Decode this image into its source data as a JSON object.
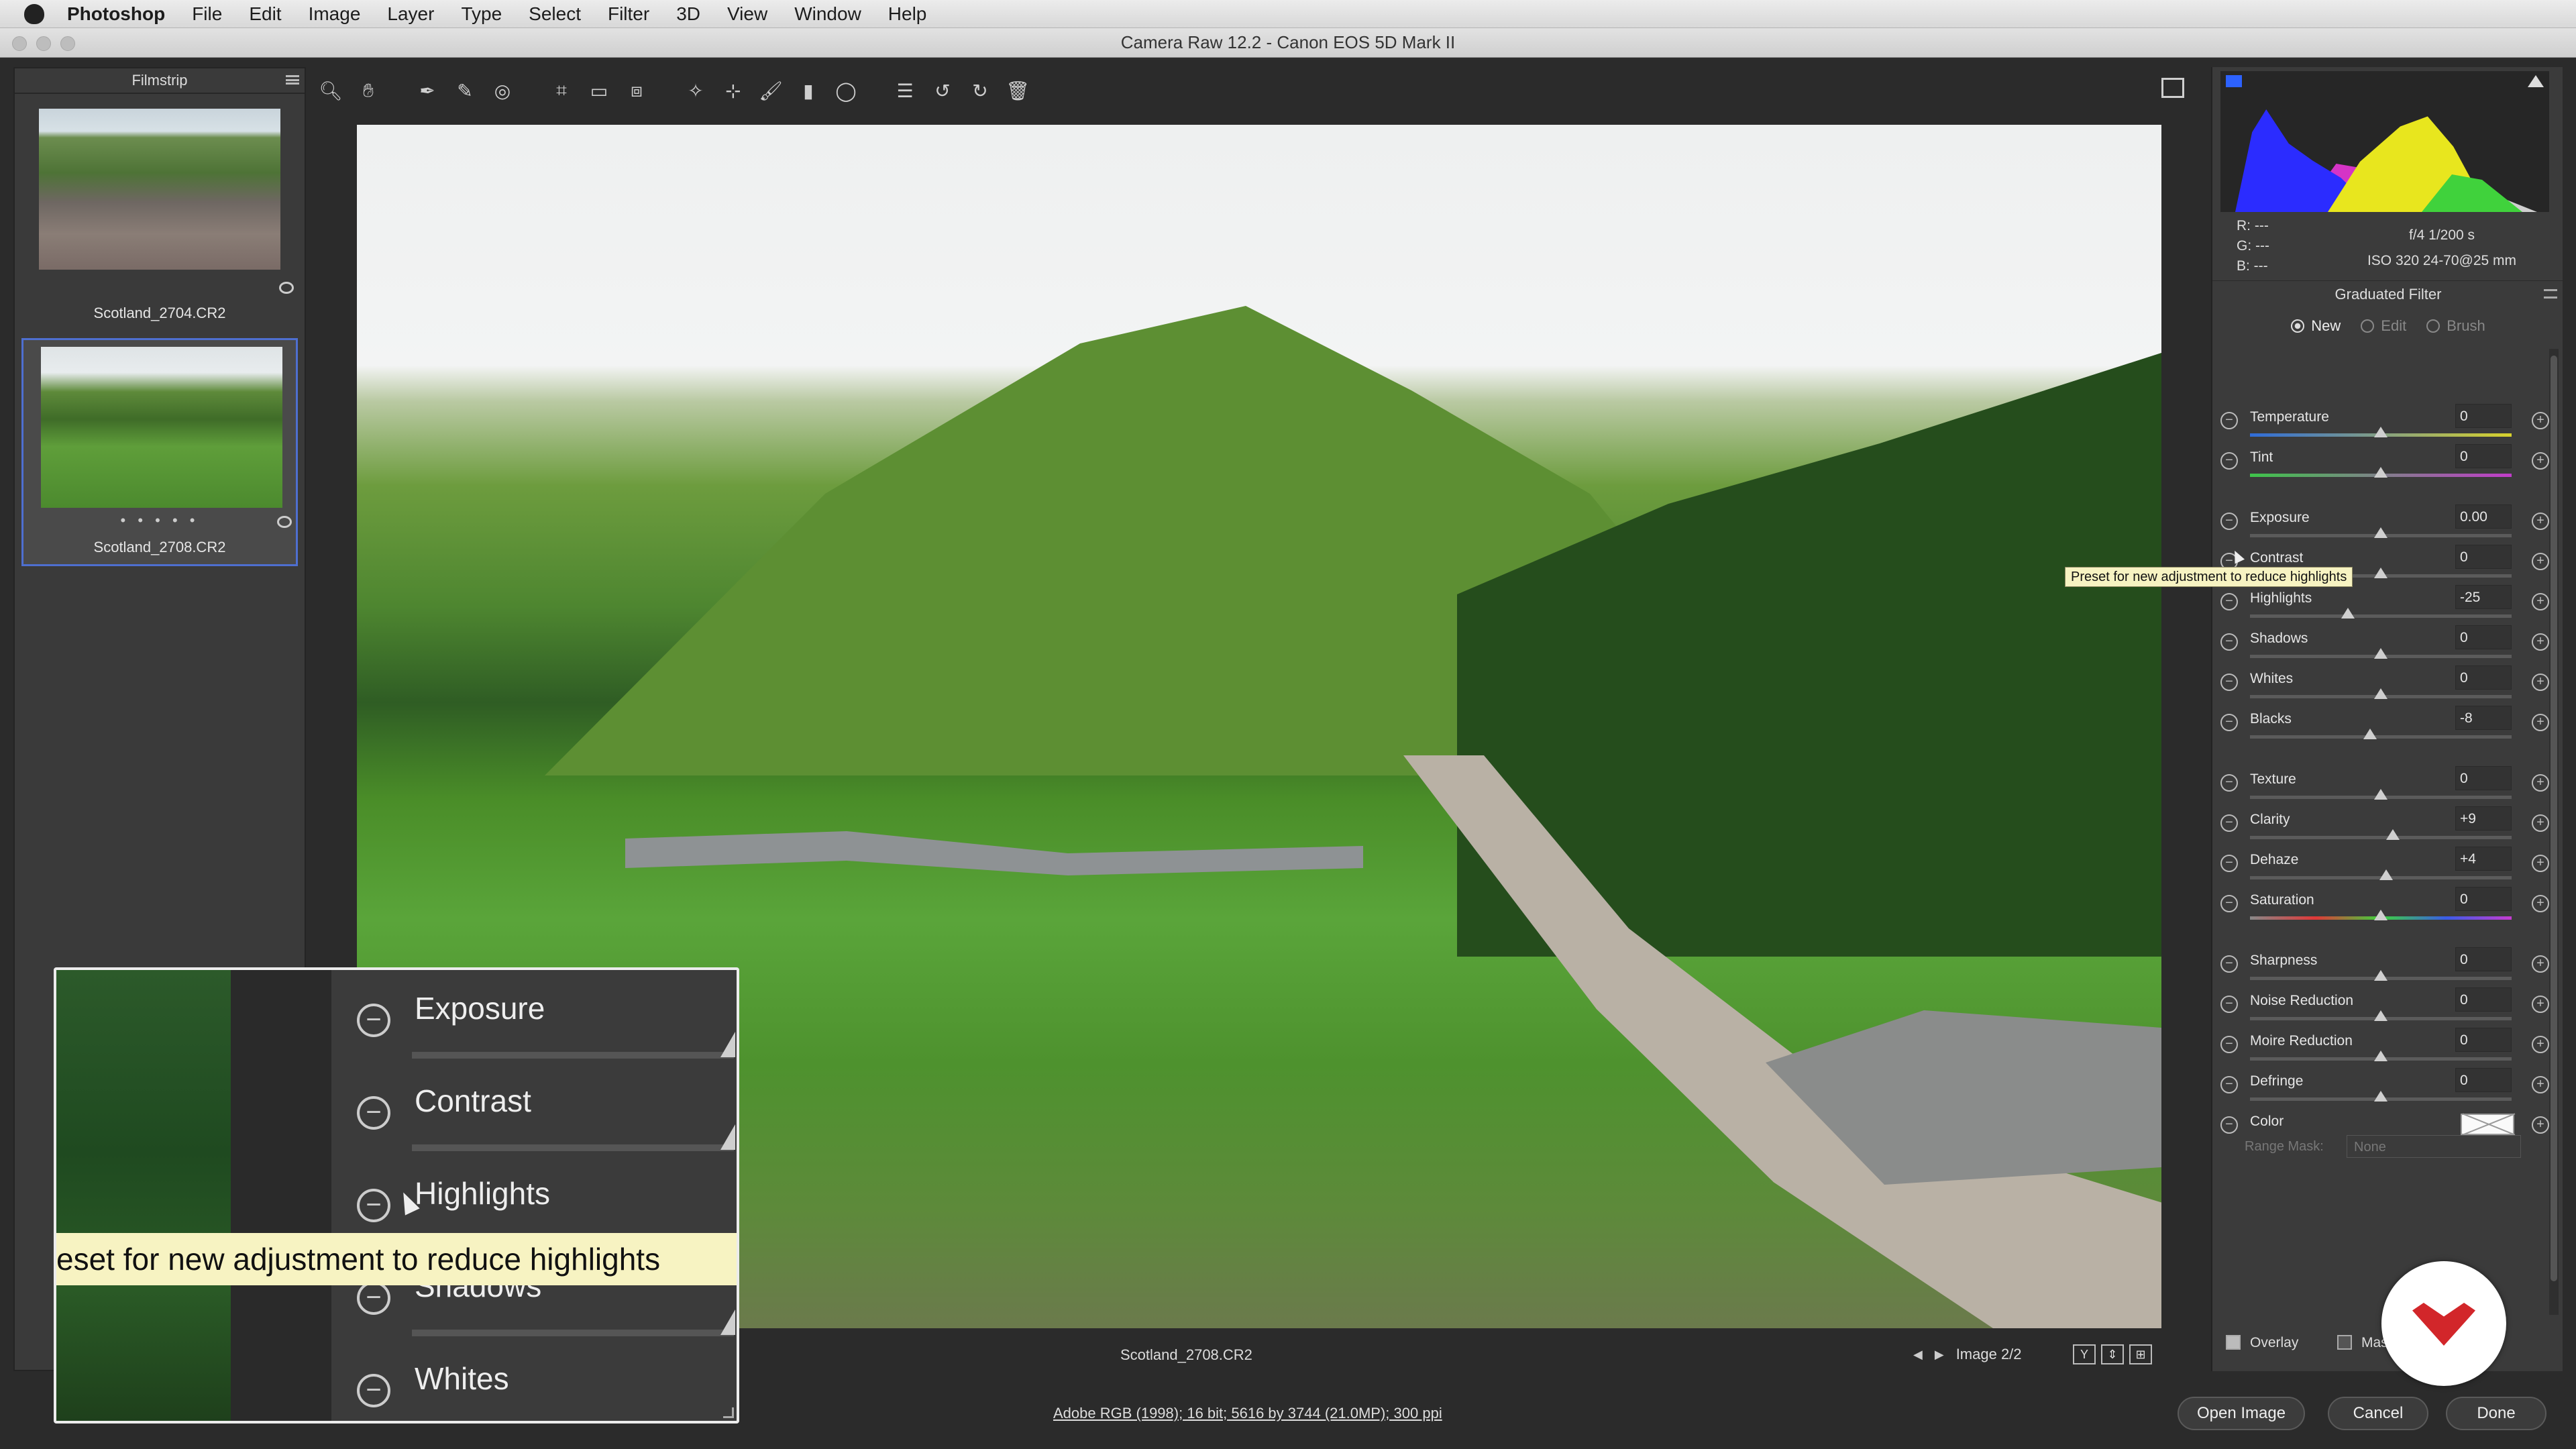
{
  "menubar": {
    "app_name": "Photoshop",
    "items": [
      "File",
      "Edit",
      "Image",
      "Layer",
      "Type",
      "Select",
      "Filter",
      "3D",
      "View",
      "Window",
      "Help"
    ]
  },
  "window": {
    "title": "Camera Raw 12.2  -  Canon EOS 5D Mark II"
  },
  "filmstrip": {
    "title": "Filmstrip",
    "items": [
      {
        "name": "Scotland_2704.CR2",
        "selected": false
      },
      {
        "name": "Scotland_2708.CR2",
        "selected": true
      }
    ],
    "dots": "• • • • •"
  },
  "statusrow": {
    "filename": "Scotland_2708.CR2",
    "image_counter": "Image 2/2",
    "view_modes": [
      "Y",
      "⇕",
      "⊞"
    ]
  },
  "footer": {
    "workflow_info": "Adobe RGB (1998); 16 bit; 5616 by 3744 (21.0MP); 300 ppi",
    "open_image": "Open Image",
    "cancel": "Cancel",
    "done": "Done"
  },
  "readout": {
    "r": "R:   ---",
    "g": "G:   ---",
    "b": "B:   ---",
    "exposure": "f/4    1/200 s",
    "iso_lens": "ISO 320    24-70@25 mm"
  },
  "graduated_filter": {
    "title": "Graduated Filter",
    "modes": [
      {
        "label": "New",
        "selected": true
      },
      {
        "label": "Edit",
        "selected": false
      },
      {
        "label": "Brush",
        "selected": false
      }
    ],
    "adjustments": [
      {
        "label": "Temperature",
        "value": "0",
        "level": 0.5
      },
      {
        "label": "Tint",
        "value": "0",
        "level": 0.5
      },
      {
        "label": "Exposure",
        "value": "0.00",
        "level": 0.5
      },
      {
        "label": "Contrast",
        "value": "0",
        "level": 0.5
      },
      {
        "label": "Highlights",
        "value": "-25",
        "level": 0.375
      },
      {
        "label": "Shadows",
        "value": "0",
        "level": 0.5
      },
      {
        "label": "Whites",
        "value": "0",
        "level": 0.5
      },
      {
        "label": "Blacks",
        "value": "-8",
        "level": 0.46
      },
      {
        "label": "Texture",
        "value": "0",
        "level": 0.5
      },
      {
        "label": "Clarity",
        "value": "+9",
        "level": 0.545
      },
      {
        "label": "Dehaze",
        "value": "+4",
        "level": 0.52
      },
      {
        "label": "Saturation",
        "value": "0",
        "level": 0.5
      },
      {
        "label": "Sharpness",
        "value": "0",
        "level": 0.5
      },
      {
        "label": "Noise Reduction",
        "value": "0",
        "level": 0.5
      },
      {
        "label": "Moire Reduction",
        "value": "0",
        "level": 0.5
      },
      {
        "label": "Defringe",
        "value": "0",
        "level": 0.5
      }
    ],
    "color_label": "Color",
    "range_mask_label": "Range Mask:",
    "range_mask_value": "None",
    "overlay_label": "Overlay",
    "mask_label": "Mas"
  },
  "tooltip": {
    "text": "Preset for new adjustment to reduce highlights"
  },
  "zoom_inset": {
    "rows": [
      "Exposure",
      "Contrast",
      "Highlights",
      "Shadows",
      "Whites"
    ],
    "tooltip": "eset for new adjustment to reduce highlights"
  },
  "colors": {
    "accent_selection": "#4e6fd0",
    "tooltip_bg": "#f7f3c2",
    "logo_red": "#d2262a"
  },
  "icons": {
    "toolbar": [
      "zoom-icon",
      "hand-icon",
      "white-balance-icon",
      "color-sampler-icon",
      "targeted-adjustment-icon",
      "crop-icon",
      "straighten-icon",
      "transform-icon",
      "spot-removal-icon",
      "red-eye-icon",
      "adjustment-brush-icon",
      "graduated-filter-icon",
      "radial-filter-icon",
      "preferences-icon",
      "rotate-left-icon",
      "rotate-right-icon",
      "trash-icon"
    ]
  }
}
